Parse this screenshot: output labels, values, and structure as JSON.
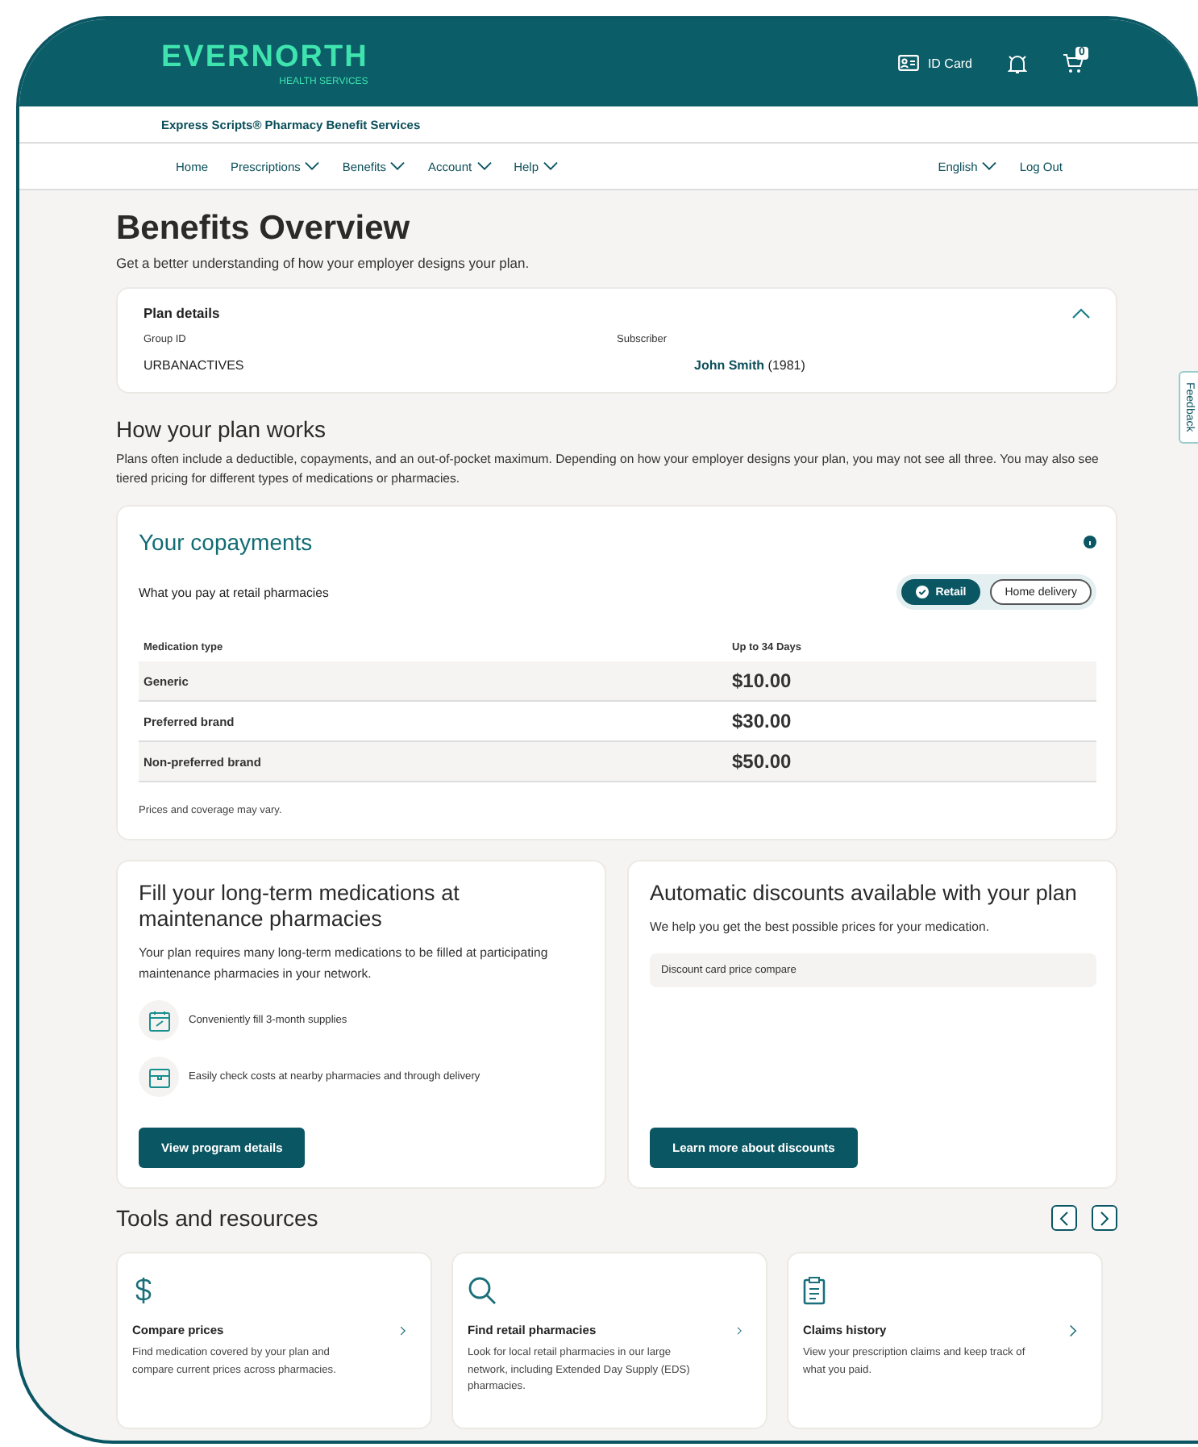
{
  "header": {
    "logo": "EVERNORTH",
    "logo_tagline": "HEALTH SERVICES",
    "id_card": "ID Card",
    "cart_count": "0"
  },
  "brand_bar": "Express Scripts® Pharmacy Benefit Services",
  "nav": {
    "items": [
      {
        "label": "Home",
        "has_menu": false
      },
      {
        "label": "Prescriptions",
        "has_menu": true
      },
      {
        "label": "Benefits",
        "has_menu": true
      },
      {
        "label": "Account",
        "has_menu": true
      },
      {
        "label": "Help",
        "has_menu": true
      }
    ],
    "right_items": [
      {
        "label": "English",
        "has_menu": true
      },
      {
        "label": "Log Out",
        "has_menu": false
      }
    ]
  },
  "page": {
    "title": "Benefits Overview",
    "subtitle": "Get a better understanding of how your employer designs your plan."
  },
  "plan_details": {
    "title": "Plan details",
    "expanded": true,
    "fields": [
      {
        "label": "Group ID",
        "value": "URBANACTIVES"
      },
      {
        "label": "Subscriber",
        "value": "**John Smith** (1981)"
      }
    ]
  },
  "how_it_works": {
    "heading": "How your plan works",
    "text": "Plans often include a deductible, copayments, and an out-of-pocket maximum. Depending on how your employer designs your plan, you may not see all three. You may also see tiered pricing for different types of medications or pharmacies."
  },
  "copayments": {
    "title": "Your copayments",
    "subtitle": "What you pay at retail pharmacies",
    "options": [
      {
        "label": "Retail",
        "selected": true
      },
      {
        "label": "Home delivery",
        "selected": false
      }
    ],
    "columns": [
      "Medication type",
      "Up to 34 Days"
    ],
    "rows": [
      {
        "type": "Generic",
        "price": "$10.00"
      },
      {
        "type": "Preferred brand",
        "price": "$30.00"
      },
      {
        "type": "Non-preferred brand",
        "price": "$50.00"
      }
    ],
    "note": "Prices and coverage may vary."
  },
  "promo_cards": [
    {
      "title": "Fill your long-term medications at maintenance pharmacies",
      "text": "Your plan requires many long-term medications to be filled at participating maintenance pharmacies in your network.",
      "features": [
        {
          "kind": "calendar",
          "text": "Conveniently fill 3-month supplies"
        },
        {
          "kind": "box",
          "text": "Easily check costs at nearby pharmacies and through delivery"
        }
      ],
      "button": "View program details"
    },
    {
      "title": "Automatic discounts available with your plan",
      "text": "We help you get the best possible prices for your medication.",
      "link_row": "Discount card price compare",
      "button": "Learn more about discounts"
    }
  ],
  "tools": {
    "heading": "Tools and resources",
    "items": [
      {
        "kind": "dollar",
        "title": "Compare prices",
        "text": "Find medication covered by your plan and compare current prices across pharmacies."
      },
      {
        "kind": "search",
        "title": "Find retail pharmacies",
        "text": "Look for local retail pharmacies in our large network, including Extended Day Supply (EDS) pharmacies."
      },
      {
        "kind": "clipboard",
        "title": "Claims history",
        "text": "View your prescription claims and keep track of what you paid."
      }
    ]
  },
  "feedback": "Feedback"
}
